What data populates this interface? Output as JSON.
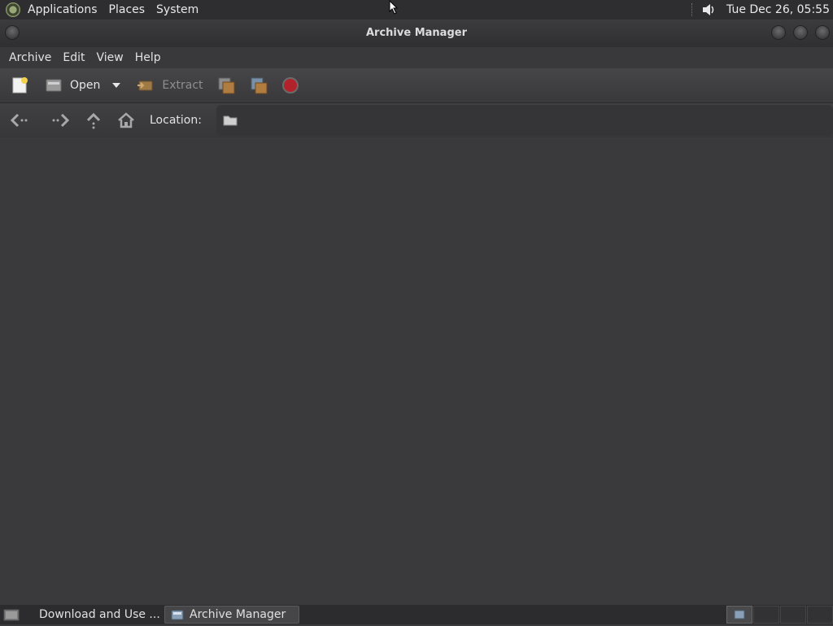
{
  "top_panel": {
    "menus": [
      "Applications",
      "Places",
      "System"
    ],
    "clock": "Tue Dec 26, 05:55"
  },
  "window": {
    "title": "Archive Manager",
    "menubar": [
      "Archive",
      "Edit",
      "View",
      "Help"
    ],
    "toolbar": {
      "open_label": "Open",
      "extract_label": "Extract"
    },
    "location": {
      "label": "Location:"
    }
  },
  "taskbar": {
    "tasks": [
      {
        "label": "Download and Use ...",
        "icon": "chrome-icon"
      },
      {
        "label": "Archive Manager",
        "icon": "archive-manager-icon"
      }
    ]
  },
  "colors": {
    "stop_red": "#b3222a",
    "panel_bg": "#2e2e30",
    "window_bg": "#3a3a3c"
  }
}
